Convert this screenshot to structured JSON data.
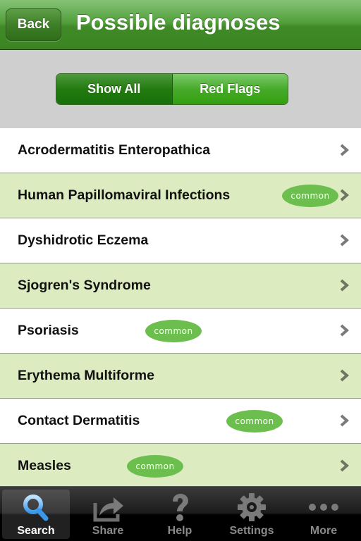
{
  "navbar": {
    "back_label": "Back",
    "title": "Possible diagnoses"
  },
  "filter": {
    "segments": [
      {
        "label": "Show All",
        "selected": true
      },
      {
        "label": "Red Flags",
        "selected": false
      }
    ]
  },
  "diagnoses": [
    {
      "name": "Acrodermatitis Enteropathica",
      "badge": null,
      "style": "white"
    },
    {
      "name": "Human Papillomaviral Infections",
      "badge": "common",
      "style": "green"
    },
    {
      "name": "Dyshidrotic Eczema",
      "badge": null,
      "style": "white"
    },
    {
      "name": "Sjogren's Syndrome",
      "badge": null,
      "style": "green"
    },
    {
      "name": "Psoriasis",
      "badge": "common",
      "style": "white"
    },
    {
      "name": "Erythema Multiforme",
      "badge": null,
      "style": "green"
    },
    {
      "name": "Contact Dermatitis",
      "badge": "common",
      "style": "white"
    },
    {
      "name": "Measles",
      "badge": "common",
      "style": "green"
    }
  ],
  "tabbar": {
    "tabs": [
      {
        "label": "Search",
        "icon": "search-icon",
        "active": true
      },
      {
        "label": "Share",
        "icon": "share-icon",
        "active": false
      },
      {
        "label": "Help",
        "icon": "help-icon",
        "active": false
      },
      {
        "label": "Settings",
        "icon": "settings-gear-icon",
        "active": false
      },
      {
        "label": "More",
        "icon": "more-dots-icon",
        "active": false
      }
    ]
  },
  "colors": {
    "nav_green": "#3f8a27",
    "row_green": "#dcebc0",
    "badge_green": "#6cbf4f",
    "chevron_gray": "#7a7a7a",
    "search_icon_blue": "#4aa6f0"
  }
}
